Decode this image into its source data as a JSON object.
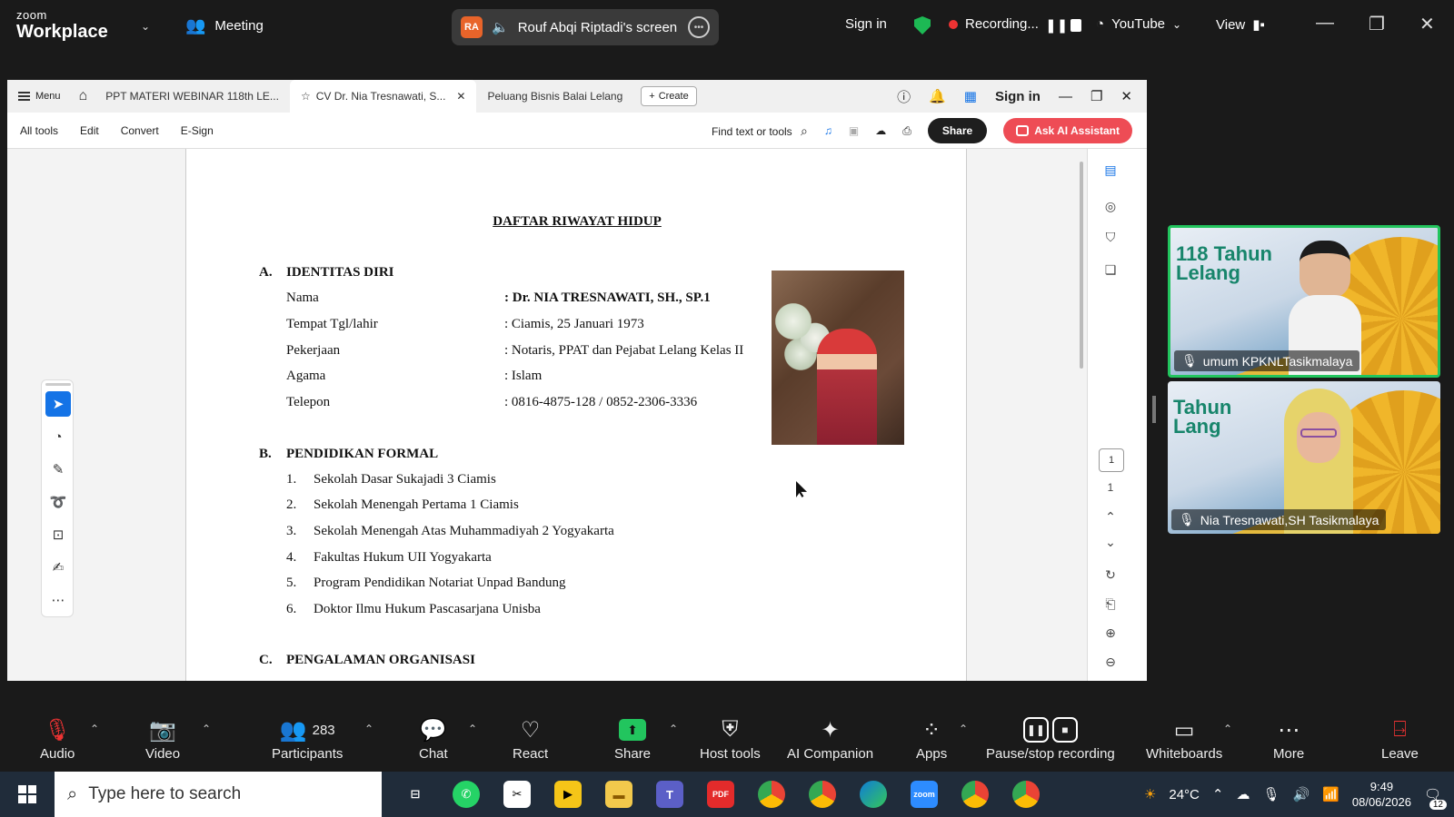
{
  "zoom_top": {
    "brand_small": "zoom",
    "brand_big": "Workplace",
    "meeting_label": "Meeting",
    "presenter_initials": "RA",
    "screen_label": "Rouf Abqi Riptadi's screen",
    "sign_in": "Sign in",
    "recording": "Recording...",
    "youtube": "YouTube",
    "view": "View"
  },
  "acrobat": {
    "menu": "Menu",
    "tabs": [
      {
        "label": "PPT MATERI WEBINAR 118th LE..."
      },
      {
        "label": "CV Dr. Nia Tresnawati, S..."
      },
      {
        "label": "Peluang Bisnis Balai Lelang"
      }
    ],
    "create": "Create",
    "sign_in": "Sign in",
    "toolbar": {
      "all_tools": "All tools",
      "edit": "Edit",
      "convert": "Convert",
      "esign": "E-Sign",
      "find": "Find text or tools",
      "share": "Share",
      "ask_ai": "Ask AI Assistant"
    },
    "page_number": "1",
    "page_total": "1"
  },
  "document": {
    "title": "DAFTAR RIWAYAT HIDUP",
    "section_a": {
      "letter": "A.",
      "title": "IDENTITAS DIRI"
    },
    "identity": [
      {
        "label": "Nama",
        "value": ": Dr. NIA TRESNAWATI, SH., SP.1"
      },
      {
        "label": "Tempat Tgl/lahir",
        "value": ": Ciamis, 25 Januari  1973"
      },
      {
        "label": "Pekerjaan",
        "value": ": Notaris, PPAT dan Pejabat Lelang Kelas II"
      },
      {
        "label": "Agama",
        "value": ": Islam"
      },
      {
        "label": "Telepon",
        "value": ": 0816-4875-128 / 0852-2306-3336"
      }
    ],
    "section_b": {
      "letter": "B.",
      "title": "PENDIDIKAN FORMAL"
    },
    "education": [
      {
        "n": "1.",
        "text": "Sekolah Dasar Sukajadi 3 Ciamis"
      },
      {
        "n": "2.",
        "text": "Sekolah Menengah Pertama 1 Ciamis"
      },
      {
        "n": "3.",
        "text": "Sekolah Menengah Atas Muhammadiyah 2 Yogyakarta"
      },
      {
        "n": "4.",
        "text": "Fakultas Hukum UII Yogyakarta"
      },
      {
        "n": "5.",
        "text": "Program Pendidikan Notariat Unpad Bandung"
      },
      {
        "n": "6.",
        "text": "Doktor Ilmu Hukum Pascasarjana Unisba"
      }
    ],
    "section_c": {
      "letter": "C.",
      "title": "PENGALAMAN ORGANISASI"
    }
  },
  "videos": [
    {
      "name": "umum KPKNLTasikmalaya",
      "banner": "118 Tahun Lelang"
    },
    {
      "name": "Nia Tresnawati,SH Tasikmalaya",
      "banner": "Tahun Lang"
    }
  ],
  "controls": {
    "audio": "Audio",
    "video": "Video",
    "participants": "Participants",
    "participant_count": "283",
    "chat": "Chat",
    "react": "React",
    "share": "Share",
    "host_tools": "Host tools",
    "ai_companion": "AI Companion",
    "apps": "Apps",
    "pause_stop": "Pause/stop recording",
    "whiteboards": "Whiteboards",
    "more": "More",
    "leave": "Leave"
  },
  "taskbar": {
    "search_placeholder": "Type here to search",
    "temperature": "24°C",
    "time": "9:49",
    "date": "08/06/2026",
    "notifications": "12"
  },
  "colors": {
    "zoom_bg": "#1a1a1a",
    "accent_green": "#22c55e",
    "acrobat_red": "#ee4c55",
    "taskbar_bg": "#202c3a"
  }
}
